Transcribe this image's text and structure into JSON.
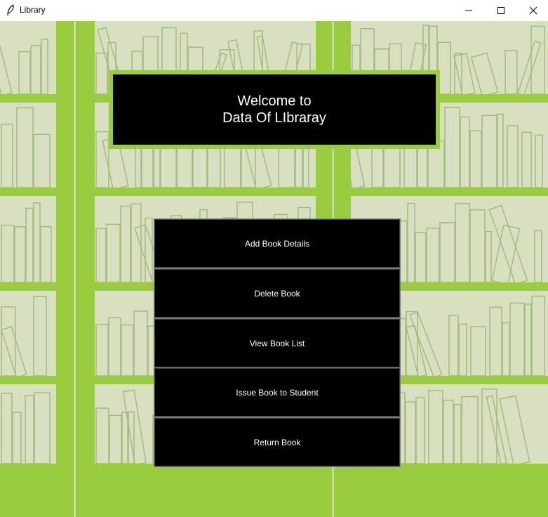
{
  "window": {
    "title": "Library",
    "app_icon": "feather-icon",
    "controls": {
      "minimize": "minimize-icon",
      "maximize": "maximize-icon",
      "close": "close-icon"
    }
  },
  "colors": {
    "background": "#d9e0c2",
    "accent_green": "#99cc3e",
    "book_outline": "#a3bb80",
    "panel": "#000000",
    "panel_text": "#ffffff"
  },
  "heading": {
    "line1": "Welcome to",
    "line2": "Data Of LIbraray"
  },
  "menu": {
    "add_book": "Add Book Details",
    "delete_book": "Delete Book",
    "view_books": "View Book List",
    "issue_book": "Issue Book to Student",
    "return_book": "Return Book"
  }
}
